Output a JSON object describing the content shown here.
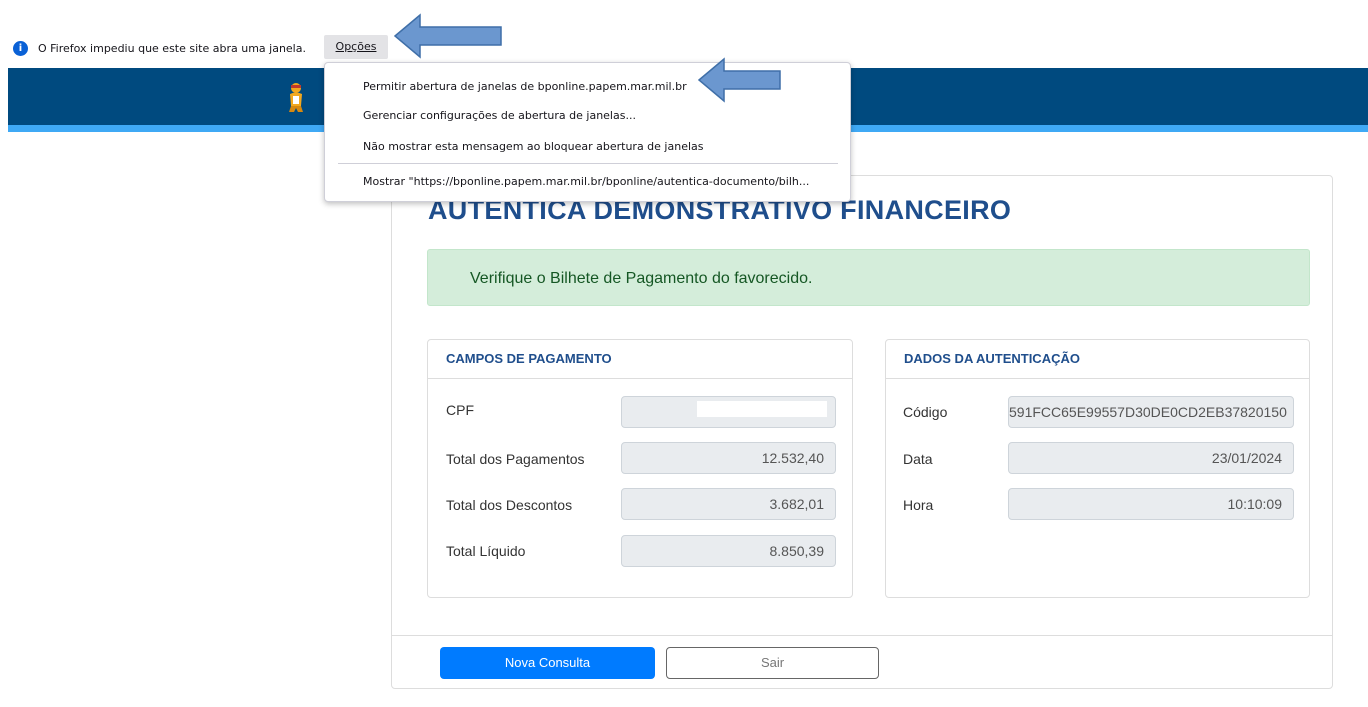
{
  "browser": {
    "notification": {
      "text": "O Firefox impediu que este site abra uma janela.",
      "options_label": "Opções"
    },
    "menu": {
      "items": [
        "Permitir abertura de janelas de bponline.papem.mar.mil.br",
        "Gerenciar configurações de abertura de janelas...",
        "Não mostrar esta mensagem ao bloquear abertura de janelas",
        "Mostrar \"https://bponline.papem.mar.mil.br/bponline/autentica-documento/bilh..."
      ]
    }
  },
  "page": {
    "title": "AUTENTICA DEMONSTRATIVO FINANCEIRO",
    "alert": "Verifique o Bilhete de Pagamento do favorecido.",
    "payment_panel": {
      "title": "CAMPOS DE PAGAMENTO",
      "rows": [
        {
          "label": "CPF",
          "value": ""
        },
        {
          "label": "Total dos Pagamentos",
          "value": "12.532,40"
        },
        {
          "label": "Total dos Descontos",
          "value": "3.682,01"
        },
        {
          "label": "Total Líquido",
          "value": "8.850,39"
        }
      ]
    },
    "auth_panel": {
      "title": "DADOS DA AUTENTICAÇÃO",
      "rows": [
        {
          "label": "Código",
          "value": "591FCC65E99557D30DE0CD2EB37820150"
        },
        {
          "label": "Data",
          "value": "23/01/2024"
        },
        {
          "label": "Hora",
          "value": "10:10:09"
        }
      ]
    },
    "buttons": {
      "new_query": "Nova Consulta",
      "exit": "Sair"
    }
  },
  "colors": {
    "header": "#004a7f",
    "header_stripe": "#3fa9f5",
    "title": "#1f4e8c",
    "primary": "#007bff",
    "alert_bg": "#d4edda",
    "annotation_arrow": "#6b97cf"
  }
}
